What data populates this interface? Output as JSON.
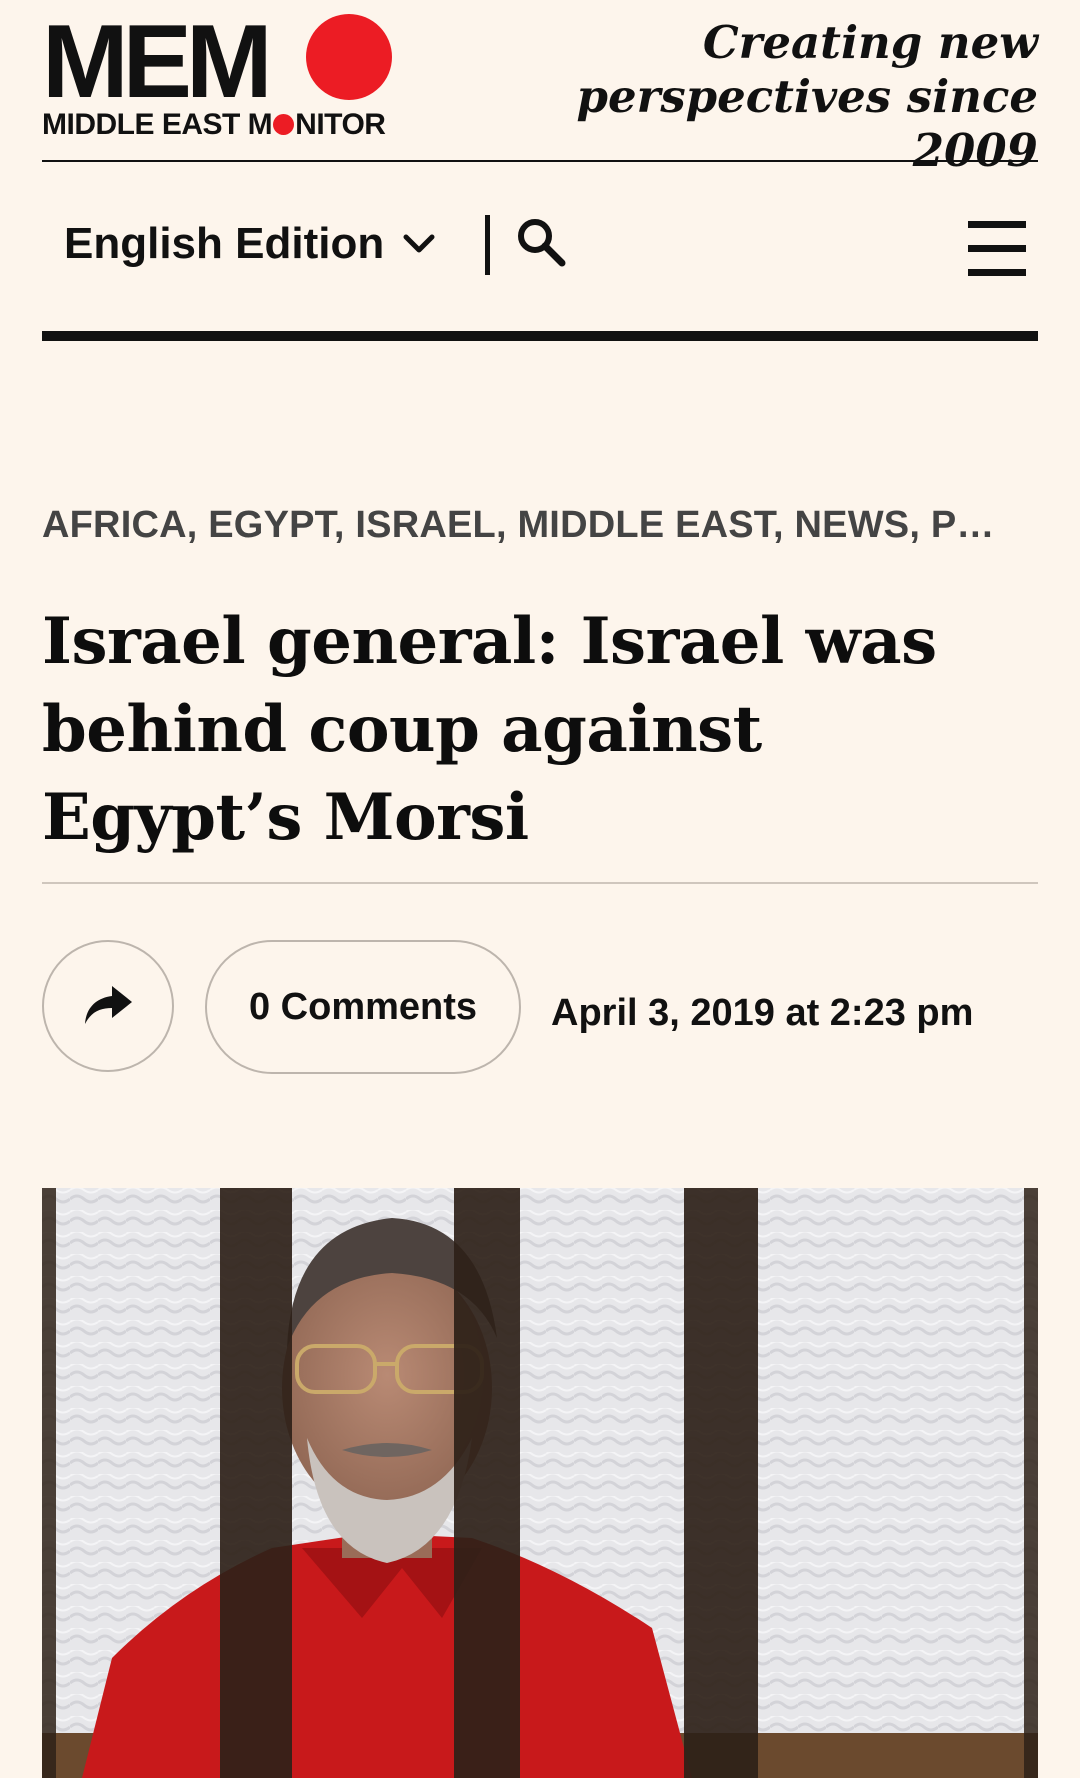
{
  "header": {
    "logo": {
      "wordmark": "MEM",
      "subtitle_before": "MIDDLE EAST M",
      "subtitle_after": "NITOR"
    },
    "tagline_line1": "Creating new",
    "tagline_line2": "perspectives since 2009"
  },
  "nav": {
    "edition_label": "English Edition",
    "edition_icon": "chevron-down-icon",
    "search_icon": "search-icon",
    "menu_icon": "hamburger-menu-icon"
  },
  "article": {
    "categories": [
      {
        "label": "AFRICA",
        "sep": ", "
      },
      {
        "label": "EGYPT",
        "sep": ", "
      },
      {
        "label": "ISRAEL",
        "sep": ", "
      },
      {
        "label": "MIDDLE EAST",
        "sep": ", "
      },
      {
        "label": "NEWS",
        "sep": ", "
      },
      {
        "label": "P…",
        "sep": ""
      }
    ],
    "headline": "Israel general: Israel was behind coup against Egypt’s Morsi",
    "share_icon": "share-arrow-icon",
    "comments_label": "0 Comments",
    "date": "April 3, 2019 at 2:23 pm"
  },
  "colors": {
    "background": "#fdf5ec",
    "brand_red": "#ec1c24",
    "text": "#111111",
    "category_text": "#444444"
  }
}
